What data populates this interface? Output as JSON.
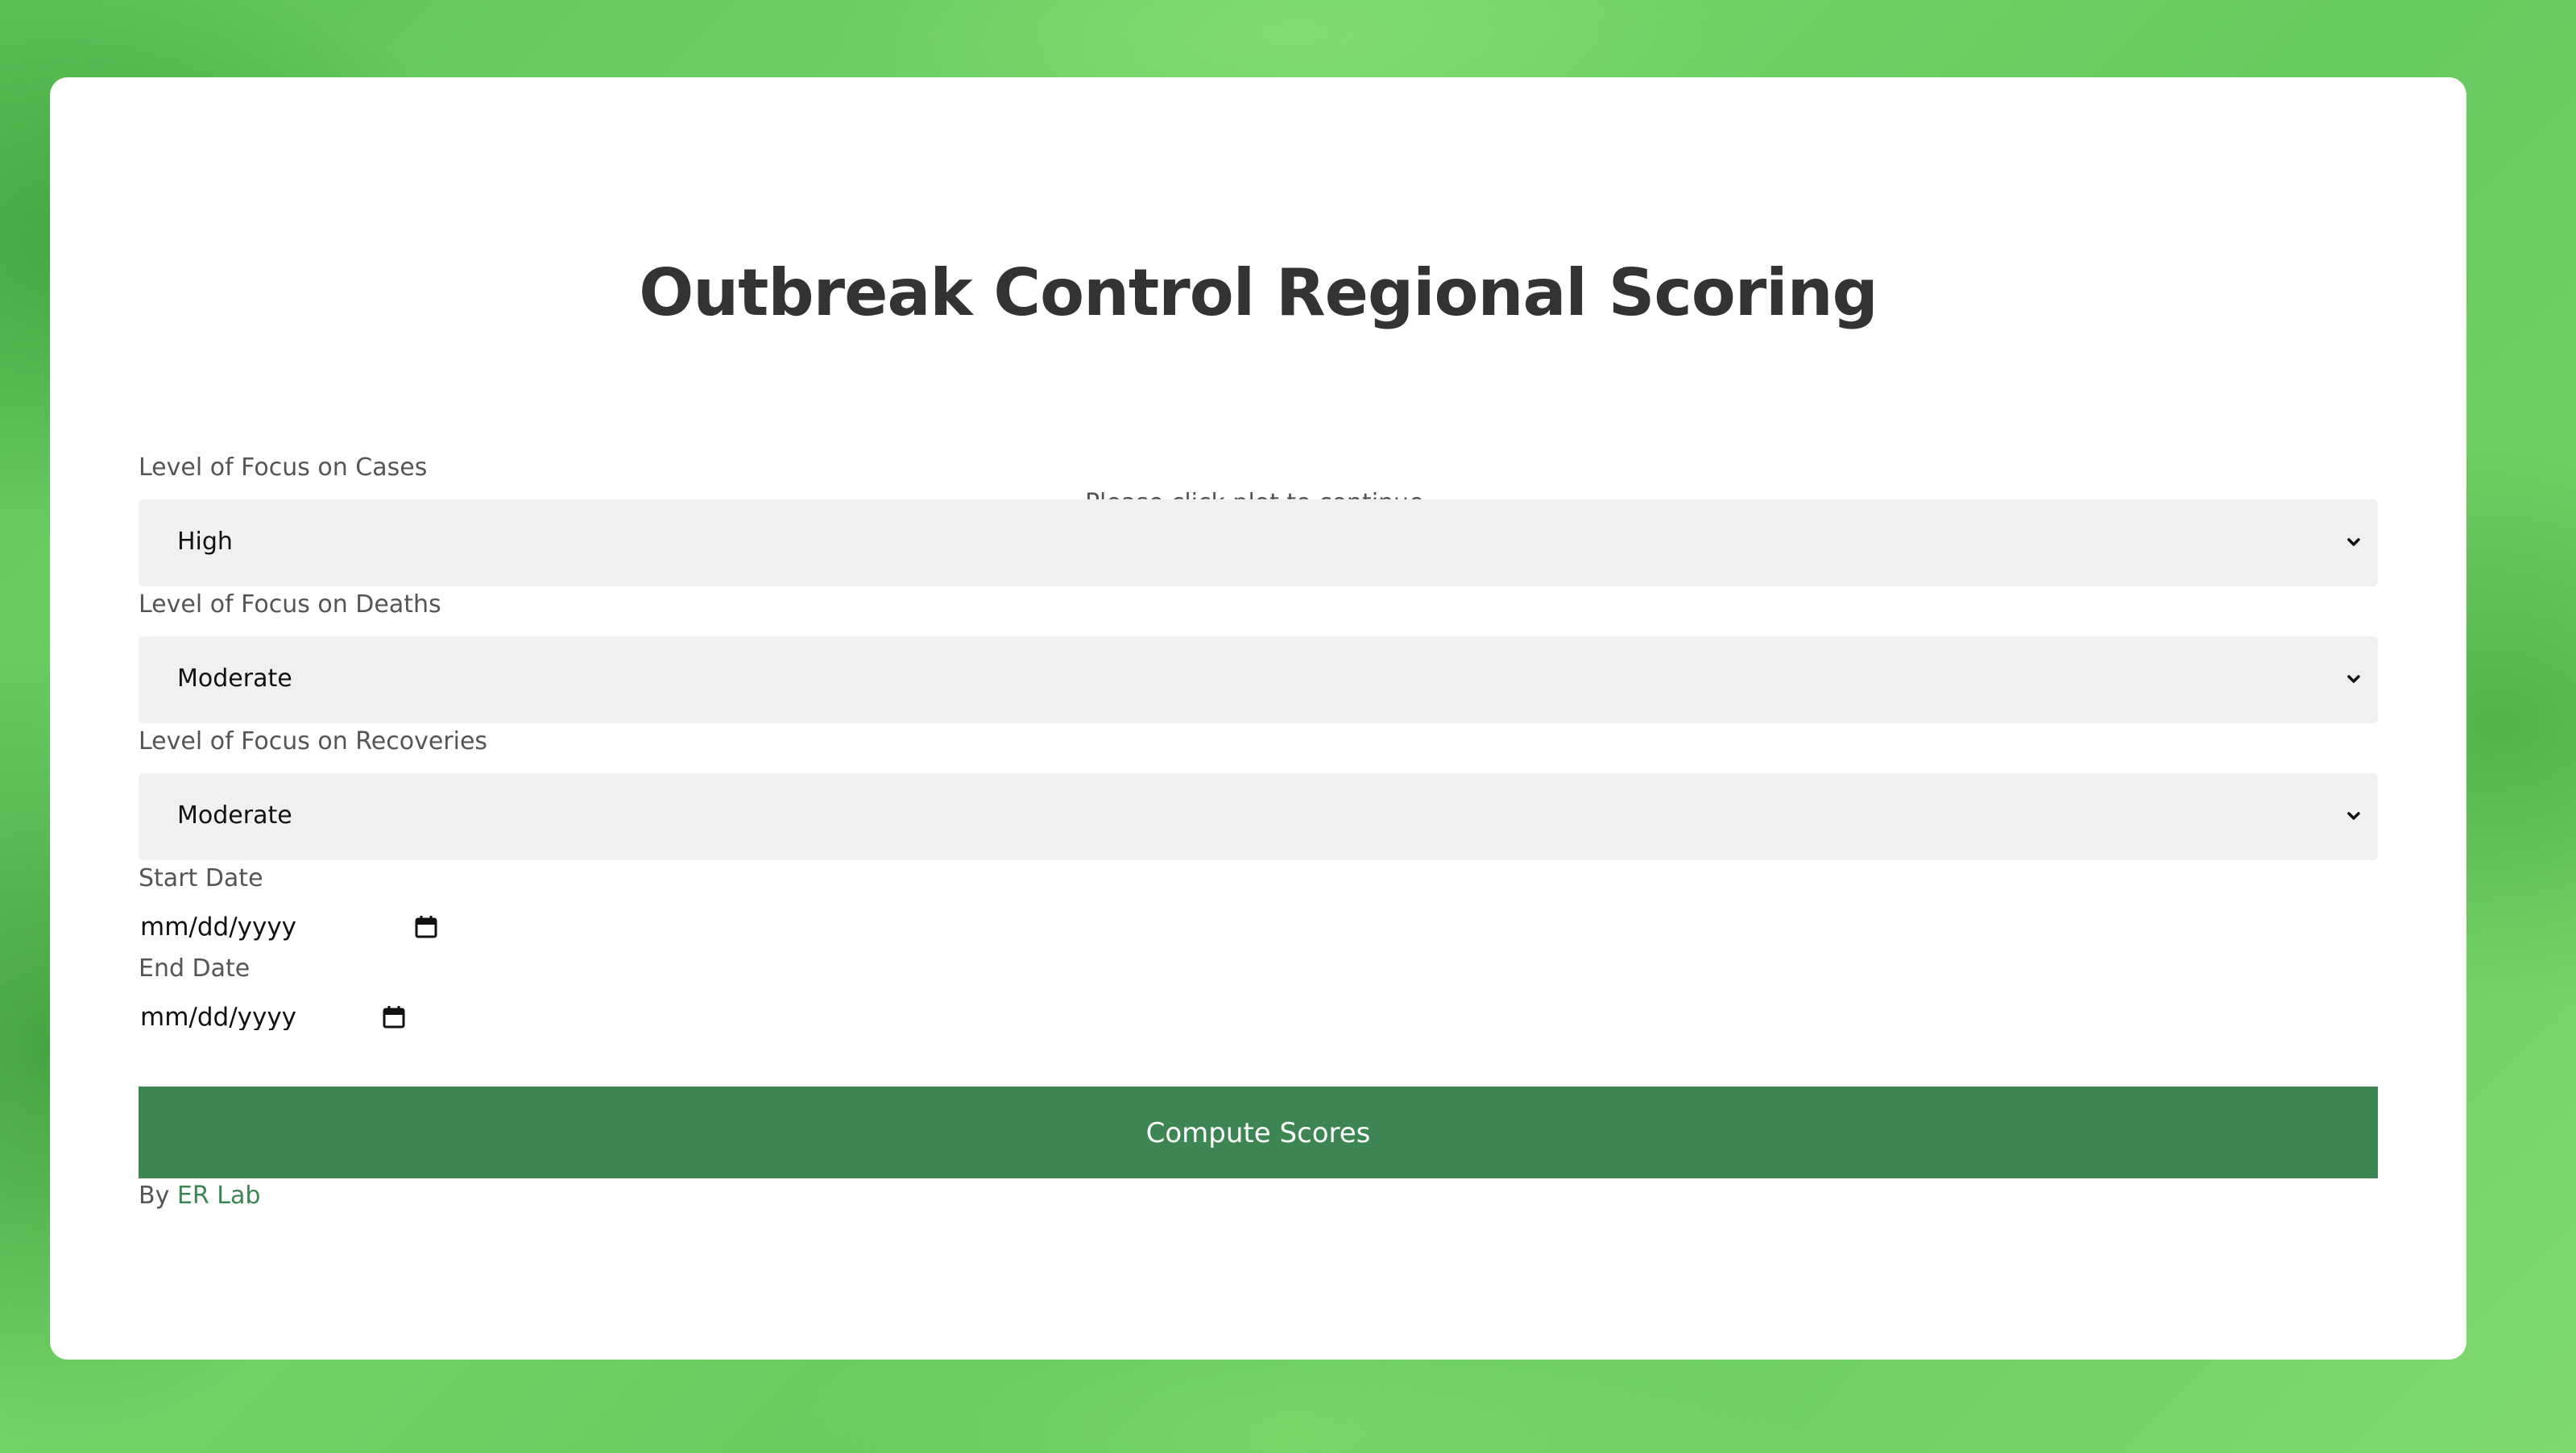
{
  "page": {
    "title": "Outbreak Control Regional Scoring",
    "hint": "Please click plot to continue."
  },
  "form": {
    "cases": {
      "label": "Level of Focus on Cases",
      "selected": "High"
    },
    "deaths": {
      "label": "Level of Focus on Deaths",
      "selected": "Moderate"
    },
    "recoveries": {
      "label": "Level of Focus on Recoveries",
      "selected": "Moderate"
    },
    "start_date": {
      "label": "Start Date",
      "placeholder": "mm/dd/yyyy"
    },
    "end_date": {
      "label": "End Date",
      "placeholder": "mm/dd/yyyy"
    },
    "submit_label": "Compute Scores"
  },
  "footer": {
    "by_prefix": "By",
    "author_link": "ER Lab"
  },
  "colors": {
    "accent": "#3d8653",
    "title_text": "#333333",
    "select_bg": "#f0f0f0"
  },
  "icons": {
    "dropdown": "chevron-down-icon",
    "date": "calendar-icon"
  }
}
